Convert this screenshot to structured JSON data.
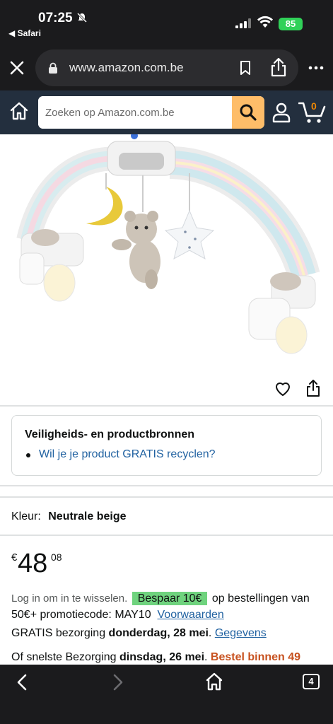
{
  "status_bar": {
    "time": "07:25",
    "back_app": "◀ Safari",
    "battery": "85"
  },
  "browser": {
    "url": "www.amazon.com.be",
    "tab_count": "4"
  },
  "amazon_header": {
    "search_placeholder": "Zoeken op Amazon.com.be",
    "cart_count": "0"
  },
  "safety_card": {
    "title": "Veiligheids- en productbronnen",
    "link": "Wil je je product GRATIS recyclen?"
  },
  "color": {
    "label": "Kleur:",
    "value": "Neutrale beige"
  },
  "price": {
    "symbol": "€",
    "whole": "48",
    "fraction": "08"
  },
  "promo": {
    "login_text": "Log in om in te wisselen.",
    "save_badge": "Bespaar 10€",
    "text": "op bestellingen van 50€+ promotiecode: MAY10",
    "terms_link": "Voorwaarden"
  },
  "delivery": {
    "prefix": "GRATIS bezorging",
    "date": "donderdag, 28 mei",
    "details_link": "Gegevens"
  },
  "fastest": {
    "prefix": "Of snelste Bezorging",
    "date": "dinsdag, 26 mei",
    "order_within": "Bestel binnen 49"
  },
  "colors": {
    "amazon_dark": "#232f3e",
    "search_button": "#febd69",
    "link": "#2162a1",
    "save_badge": "#6fd37e",
    "cta_orange": "#c7511f"
  }
}
